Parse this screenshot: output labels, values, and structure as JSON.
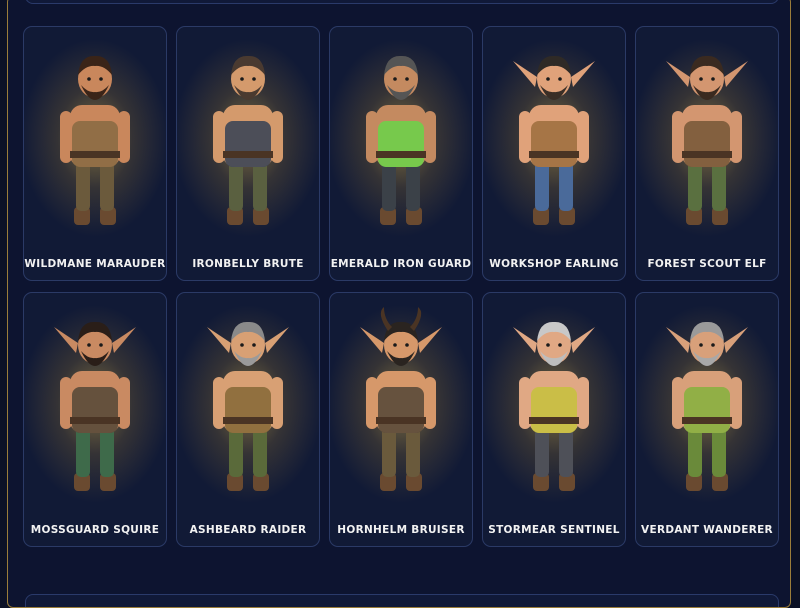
{
  "characters": [
    {
      "name": "WILDMANE MARAUDER",
      "icon": "wildmane-marauder-figure",
      "skin": "#c9875c",
      "hair": "#3a2418",
      "outfit": "#6b5a3c",
      "accent": "#8b6b44",
      "ears": false,
      "horns": false,
      "beard": "#3a2418"
    },
    {
      "name": "IRONBELLY BRUTE",
      "icon": "ironbelly-brute-figure",
      "skin": "#d49a6c",
      "hair": "#4a3a30",
      "outfit": "#5a6040",
      "accent": "#3d4656",
      "ears": false,
      "horns": false,
      "beard": "#4a3a30"
    },
    {
      "name": "EMERALD IRON GUARD",
      "icon": "emerald-iron-guard-figure",
      "skin": "#c48a60",
      "hair": "#555555",
      "outfit": "#3b4148",
      "accent": "#6fcf4a",
      "ears": false,
      "horns": false,
      "beard": "#555555"
    },
    {
      "name": "WORKSHOP EARLING",
      "icon": "workshop-earling-figure",
      "skin": "#e0a27a",
      "hair": "#2f2a26",
      "outfit": "#4a6a9a",
      "accent": "#a07040",
      "ears": true,
      "horns": false,
      "beard": "#3a2e26"
    },
    {
      "name": "FOREST SCOUT ELF",
      "icon": "forest-scout-elf-figure",
      "skin": "#d39670",
      "hair": "#3a2a20",
      "outfit": "#5a7040",
      "accent": "#7a5a3a",
      "ears": true,
      "horns": false,
      "beard": "#3a2a20"
    },
    {
      "name": "MOSSGUARD SQUIRE",
      "icon": "mossguard-squire-figure",
      "skin": "#c98a62",
      "hair": "#2a1e18",
      "outfit": "#3e6a4a",
      "accent": "#5a4a3a",
      "ears": true,
      "horns": false,
      "beard": "#2a1e18"
    },
    {
      "name": "ASHBEARD RAIDER",
      "icon": "ashbeard-raider-figure",
      "skin": "#d8a074",
      "hair": "#8a8a8a",
      "outfit": "#5a6a3a",
      "accent": "#8a6a3a",
      "ears": true,
      "horns": false,
      "beard": "#9a9a9a"
    },
    {
      "name": "HORNHELM BRUISER",
      "icon": "hornhelm-bruiser-figure",
      "skin": "#d6986a",
      "hair": "#2a2420",
      "outfit": "#6a5a3c",
      "accent": "#5a4a3a",
      "ears": true,
      "horns": true,
      "beard": "#2a2420"
    },
    {
      "name": "STORMEAR SENTINEL",
      "icon": "stormear-sentinel-figure",
      "skin": "#e0a884",
      "hair": "#c8c8c8",
      "outfit": "#4e5058",
      "accent": "#c8c040",
      "ears": true,
      "horns": false,
      "beard": "#bdbdbd"
    },
    {
      "name": "VERDANT WANDERER",
      "icon": "verdant-wanderer-figure",
      "skin": "#d8a07a",
      "hair": "#9a9a9a",
      "outfit": "#6a8a3a",
      "accent": "#8ab040",
      "ears": true,
      "horns": false,
      "beard": "#a8a8a8"
    }
  ]
}
